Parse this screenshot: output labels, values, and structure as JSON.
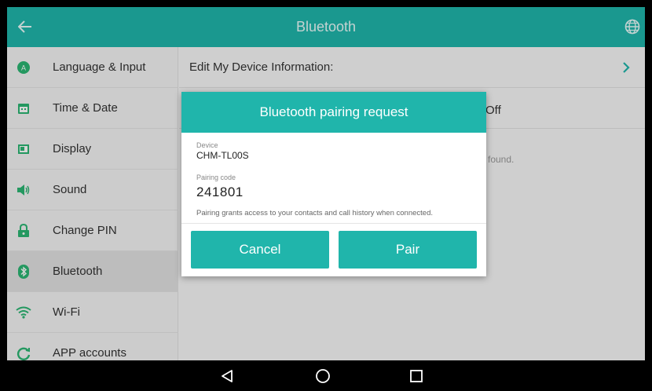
{
  "header": {
    "title": "Bluetooth",
    "back_icon": "arrow-left-icon",
    "globe_icon": "globe-icon"
  },
  "sidebar": {
    "items": [
      {
        "label": "Language & Input",
        "icon": "language-icon",
        "active": false
      },
      {
        "label": "Time & Date",
        "icon": "calendar-icon",
        "active": false
      },
      {
        "label": "Display",
        "icon": "display-icon",
        "active": false
      },
      {
        "label": "Sound",
        "icon": "speaker-icon",
        "active": false
      },
      {
        "label": "Change PIN",
        "icon": "lock-icon",
        "active": false
      },
      {
        "label": "Bluetooth",
        "icon": "bluetooth-icon",
        "active": true
      },
      {
        "label": "Wi-Fi",
        "icon": "wifi-icon",
        "active": false
      },
      {
        "label": "APP accounts",
        "icon": "sync-icon",
        "active": false
      }
    ]
  },
  "main": {
    "edit_device_label": "Edit My Device Information:",
    "bluetooth_state": "Off",
    "found_text": "found."
  },
  "dialog": {
    "title": "Bluetooth pairing request",
    "device_label": "Device",
    "device_name": "CHM-TL00S",
    "code_label": "Pairing code",
    "code_value": "241801",
    "note": "Pairing grants access to your contacts and call history when connected.",
    "cancel_label": "Cancel",
    "pair_label": "Pair"
  },
  "navbar": {
    "back_icon": "triangle-back-icon",
    "home_icon": "circle-home-icon",
    "recents_icon": "square-recents-icon"
  },
  "colors": {
    "accent": "#20b5ab",
    "sidebar_icon": "#2bb673"
  }
}
